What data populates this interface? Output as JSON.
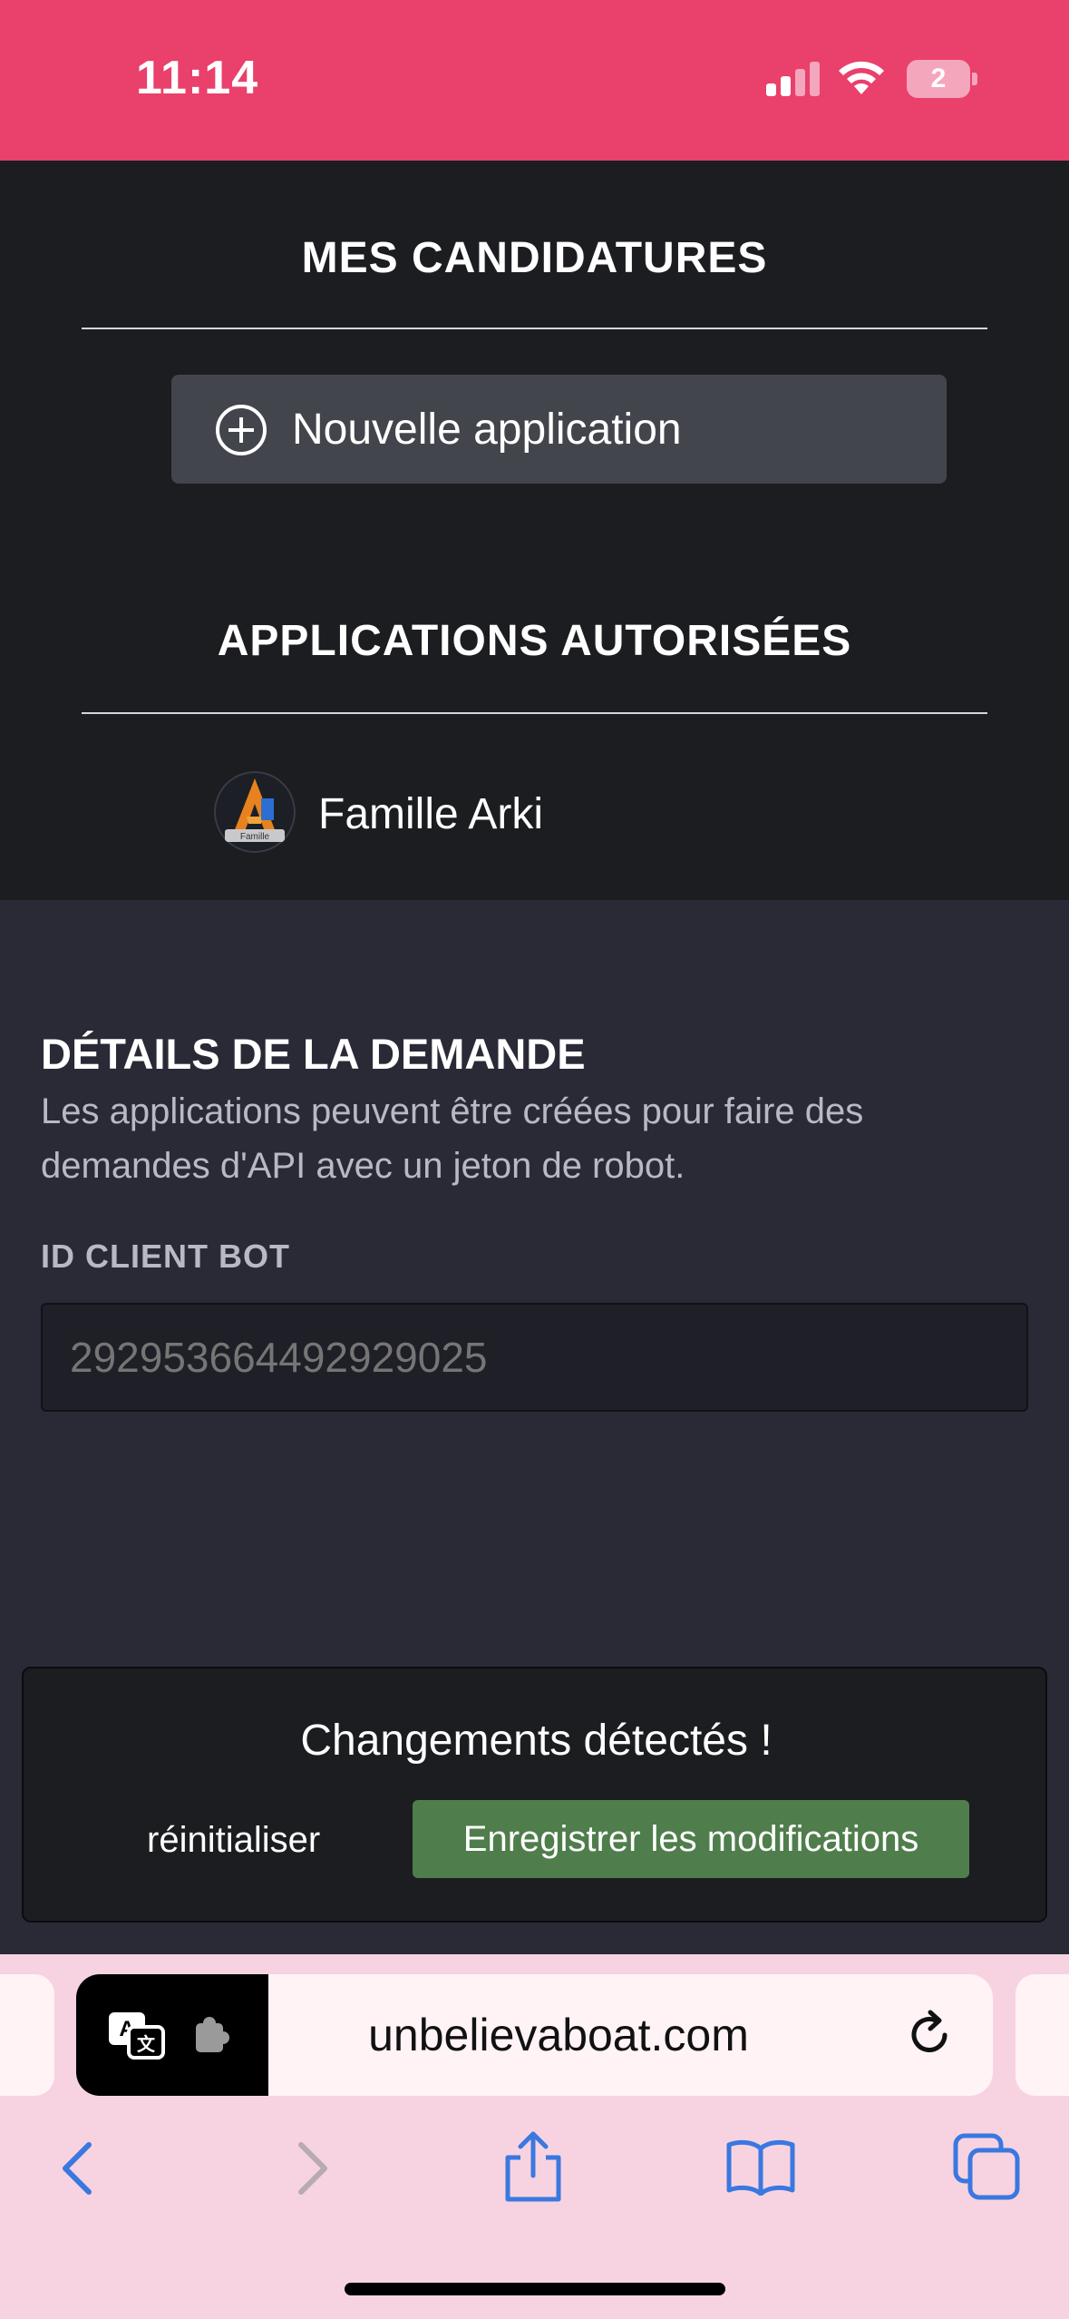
{
  "status_bar": {
    "time": "11:14",
    "battery": "2",
    "background": "#e9406c"
  },
  "authorized_apps_panel": {
    "my_applications_title": "MES CANDIDATURES",
    "new_application_label": "Nouvelle application",
    "authorized_title": "APPLICATIONS AUTORISÉES",
    "authorized_items": [
      {
        "name": "Famille Arki",
        "avatar_badge": "Famille"
      }
    ]
  },
  "request_details": {
    "title": "DÉTAILS DE LA DEMANDE",
    "description": "Les applications peuvent être créées pour faire des demandes d'API avec un jeton de robot.",
    "client_id_label": "ID CLIENT BOT",
    "client_id_placeholder": "292953664492929025"
  },
  "changes_bar": {
    "title": "Changements détectés !",
    "reset_label": "réinitialiser",
    "save_label": "Enregistrer les modifications",
    "save_color": "#4f7e4c"
  },
  "browser": {
    "url": "unbelievaboat.com",
    "toolbar_icons": [
      "back-icon",
      "forward-icon",
      "share-icon",
      "bookmarks-icon",
      "tabs-icon"
    ],
    "accent": "#3a78e0"
  }
}
